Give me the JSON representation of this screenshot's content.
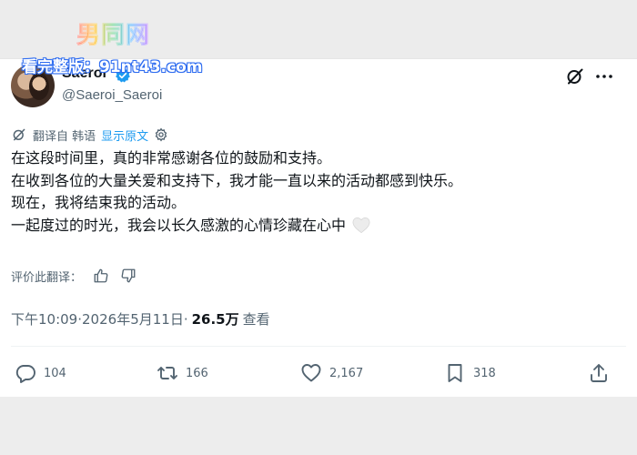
{
  "watermark": {
    "logo_text": "男同网",
    "site_text": "看完整版：91nt43.com"
  },
  "author": {
    "display_name": "Saeroi",
    "handle": "@Saeroi_Saeroi",
    "verified": true
  },
  "translation": {
    "label": "翻译自 韩语",
    "show_original": "显示原文"
  },
  "post": {
    "lines": [
      "在这段时间里，真的非常感谢各位的鼓励和支持。",
      "在收到各位的大量关爱和支持下，我才能一直以来的活动都感到快乐。",
      "现在，我将结束我的活动。",
      "一起度过的时光，我会以长久感激的心情珍藏在心中"
    ],
    "emoji": "white-heart-icon"
  },
  "rate_translation": {
    "label": "评价此翻译："
  },
  "meta": {
    "time": "下午10:09",
    "separator1": " · ",
    "date": "2026年5月11日",
    "separator2": " · ",
    "views": "26.5万",
    "views_label": "查看"
  },
  "actions": {
    "replies": "104",
    "reposts": "166",
    "likes": "2,167",
    "bookmarks": "318"
  },
  "colors": {
    "accent": "#1d9bf0",
    "secondary_text": "#536471",
    "primary_text": "#0f1419"
  }
}
